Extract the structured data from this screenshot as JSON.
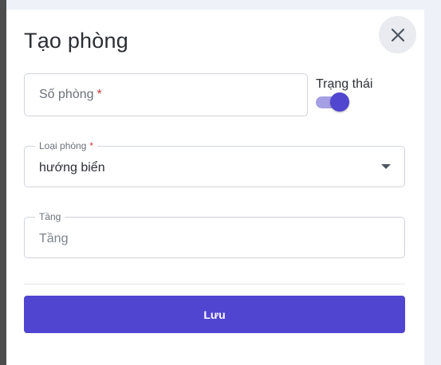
{
  "modal": {
    "title": "Tạo phòng",
    "close_icon": "close-icon"
  },
  "fields": {
    "room_number": {
      "placeholder": "Số phòng",
      "required_mark": "*"
    },
    "status": {
      "label": "Trạng thái",
      "enabled": true
    },
    "room_type": {
      "label": "Loại phòng",
      "required_mark": "*",
      "value": "hướng biển"
    },
    "floor": {
      "label": "Tầng",
      "placeholder": "Tầng"
    }
  },
  "actions": {
    "save_label": "Lưu"
  },
  "colors": {
    "primary": "#5045d1",
    "toggle_track": "#a59fe4",
    "required": "#d0393f"
  }
}
